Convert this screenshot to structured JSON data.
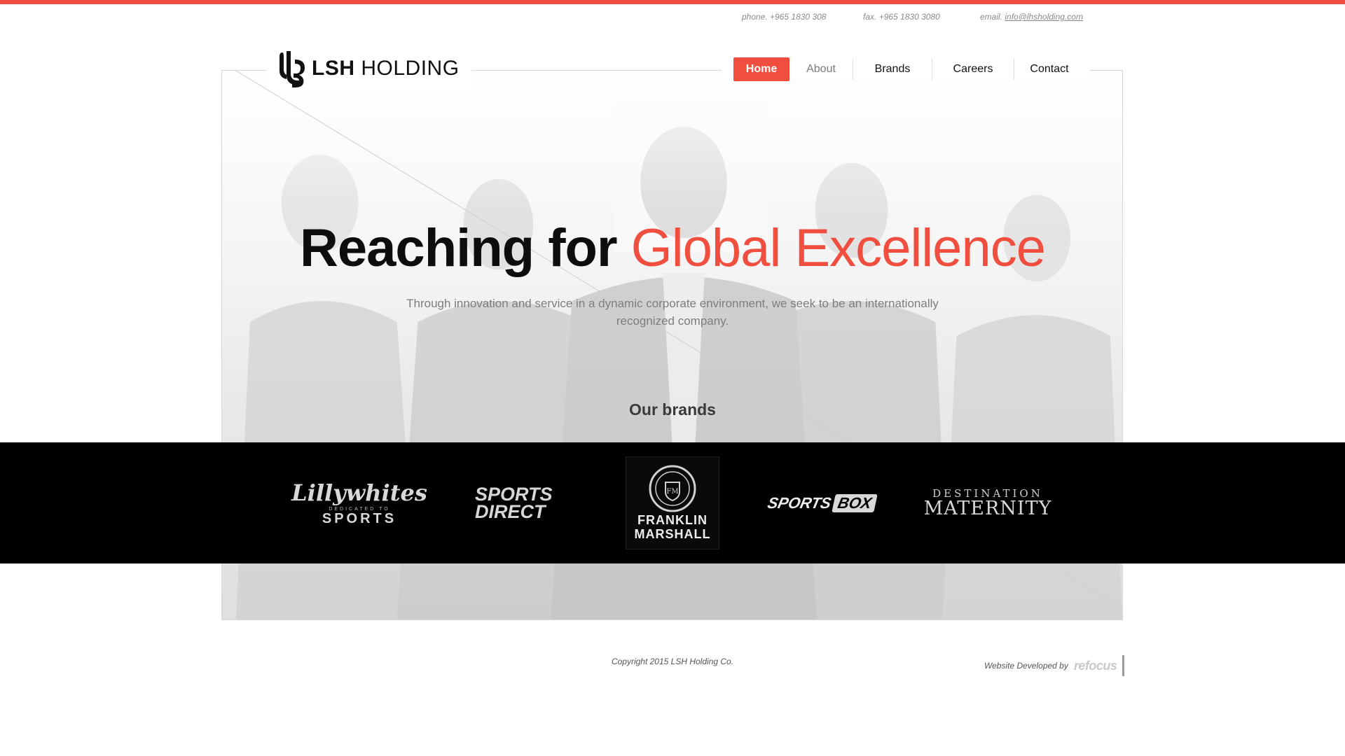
{
  "theme": {
    "accent": "#f04e3e",
    "band": "#000000",
    "text": "#111111"
  },
  "topbar": {
    "phone_label": "phone.",
    "phone": "+965 1830 308",
    "fax_label": "fax.",
    "fax": "+965 1830 3080",
    "email_label": "email.",
    "email": "info@lhsholding.com"
  },
  "logo": {
    "strong": "LSH",
    "light": "HOLDING",
    "icon": "lsh-monogram-icon"
  },
  "nav": {
    "items": [
      {
        "label": "Home",
        "active": true
      },
      {
        "label": "About",
        "active": false
      },
      {
        "label": "Brands",
        "active": false
      },
      {
        "label": "Careers",
        "active": false
      },
      {
        "label": "Contact",
        "active": false
      }
    ]
  },
  "hero": {
    "headline_dark": "Reaching for",
    "headline_accent": "Global Excellence",
    "subline": "Through innovation and service in a dynamic corporate environment, we seek to be an internationally recognized company.",
    "brands_title": "Our brands"
  },
  "brands": [
    {
      "name": "Lillywhites",
      "tagline": "DEDICATED TO",
      "sub": "SPORTS"
    },
    {
      "name": "SPORTS",
      "sub": "DIRECT"
    },
    {
      "name": "FRANKLIN",
      "sub": "MARSHALL"
    },
    {
      "name": "SPORTS",
      "sub": "BOX"
    },
    {
      "name": "DESTINATION",
      "sub": "MATERNITY"
    }
  ],
  "footer": {
    "copyright": "Copyright 2015 LSH Holding Co.",
    "developed_by": "Website Developed by",
    "developer": "refocus"
  }
}
